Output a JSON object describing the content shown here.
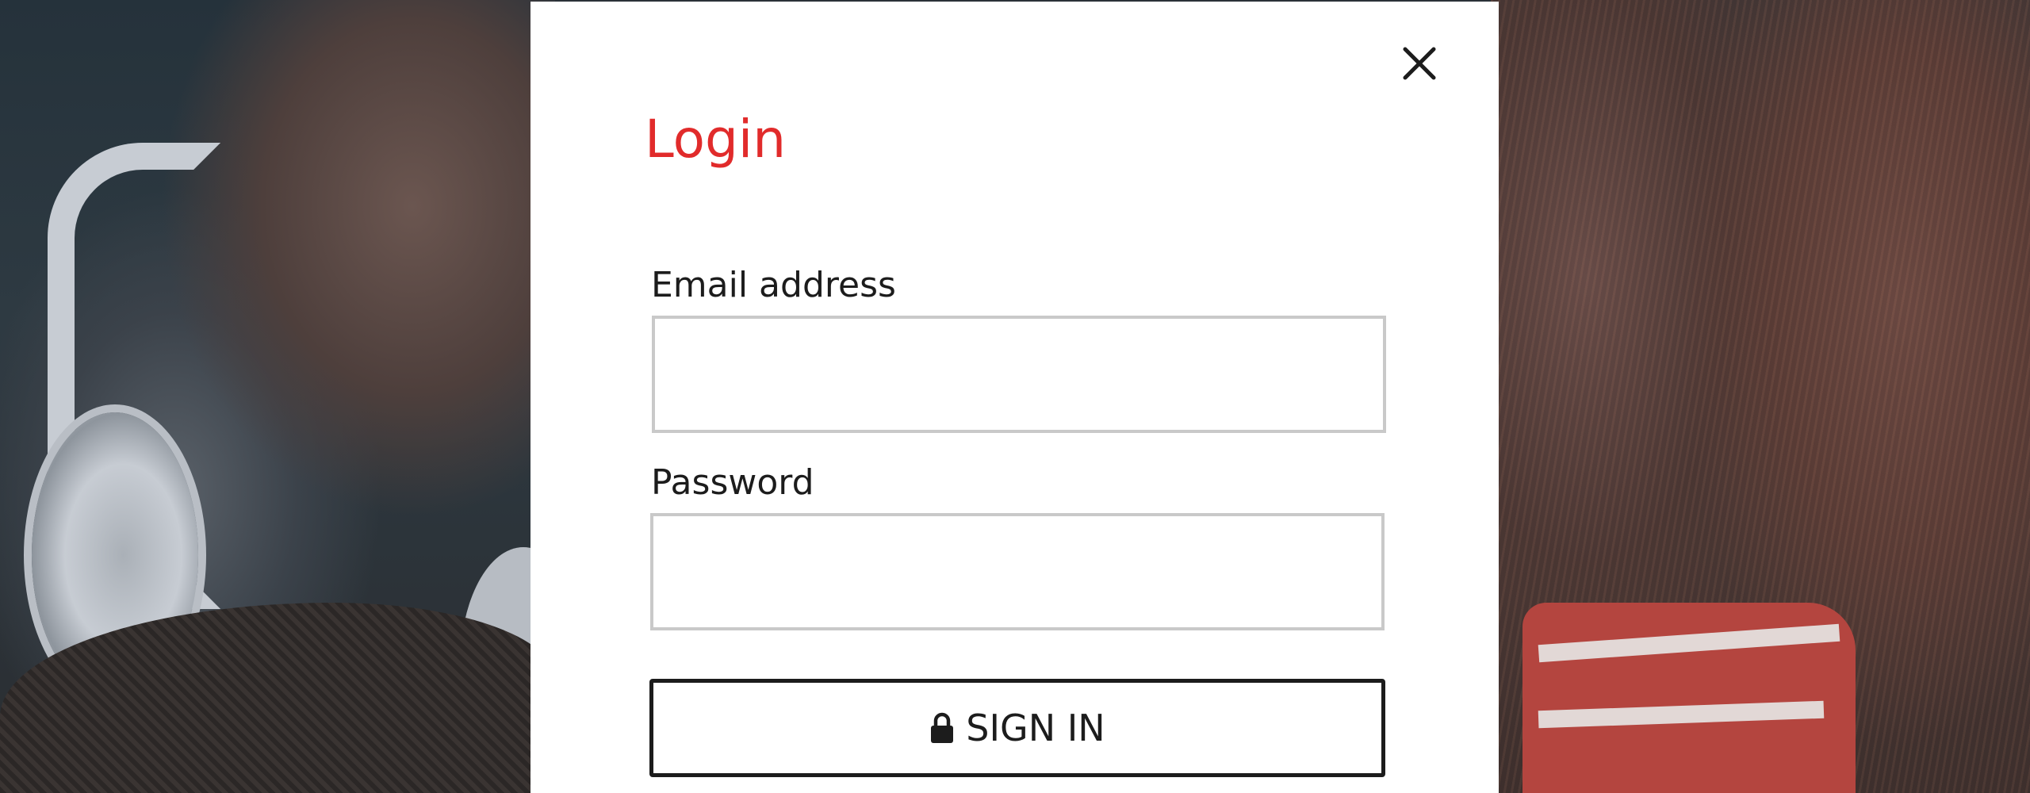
{
  "modal": {
    "title": "Login",
    "close_icon": "close-icon",
    "email": {
      "label": "Email address",
      "value": "",
      "placeholder": ""
    },
    "password": {
      "label": "Password",
      "value": "",
      "placeholder": ""
    },
    "sign_in": {
      "icon": "lock-icon",
      "label": "SIGN IN"
    }
  },
  "colors": {
    "title": "#e12b2b",
    "text": "#1c1c1c",
    "input_border": "#c9c9c9",
    "modal_background": "#ffffff"
  }
}
